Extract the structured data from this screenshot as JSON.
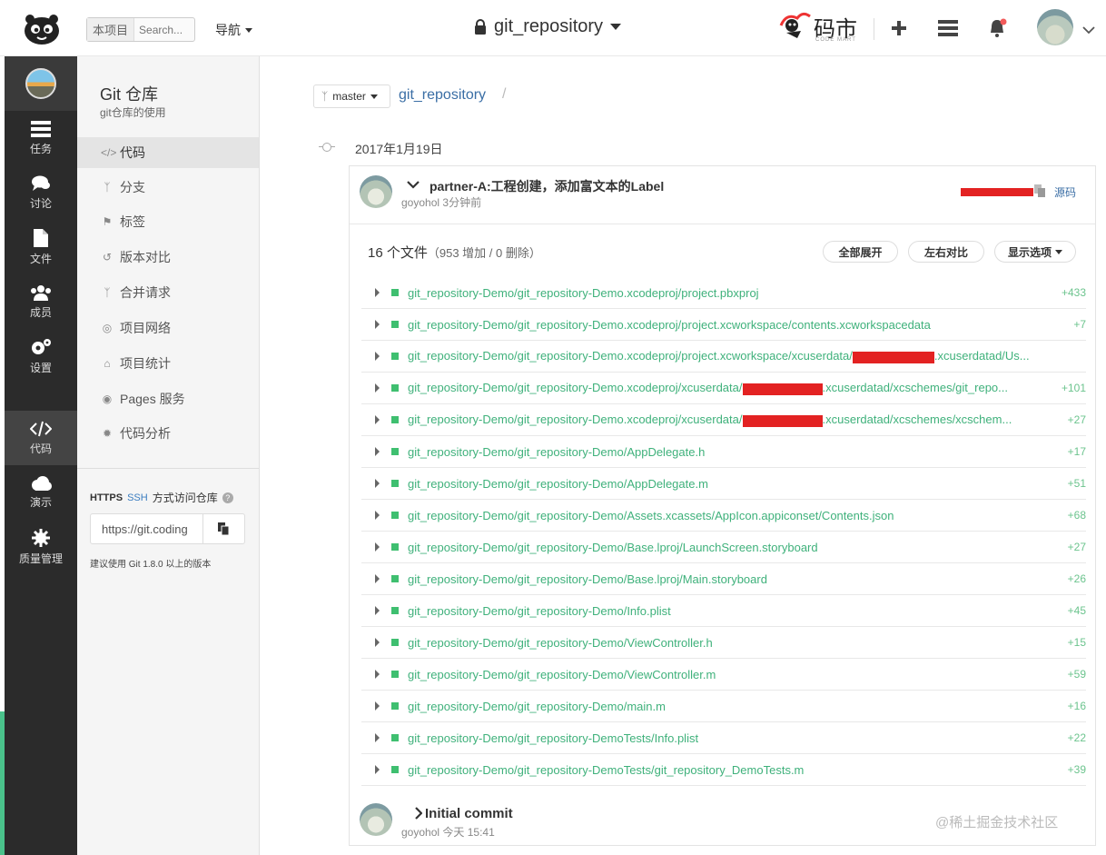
{
  "header": {
    "search_scope": "本项目",
    "search_placeholder": "Search...",
    "nav_label": "导航",
    "repo_name": "git_repository",
    "brand": "码市",
    "brand_sub": "CODE MART"
  },
  "dark_nav": [
    {
      "label": "任务",
      "icon": "tasks-icon"
    },
    {
      "label": "讨论",
      "icon": "discussion-icon"
    },
    {
      "label": "文件",
      "icon": "file-icon"
    },
    {
      "label": "成员",
      "icon": "members-icon"
    },
    {
      "label": "设置",
      "icon": "settings-icon"
    },
    {
      "label": "代码",
      "icon": "code-icon"
    },
    {
      "label": "演示",
      "icon": "cloud-icon"
    },
    {
      "label": "质量管理",
      "icon": "quality-icon"
    }
  ],
  "sidebar": {
    "title": "Git 仓库",
    "subtitle": "git仓库的使用",
    "items": [
      {
        "label": "代码",
        "icon": "code-icon"
      },
      {
        "label": "分支",
        "icon": "branch-icon"
      },
      {
        "label": "标签",
        "icon": "tag-icon"
      },
      {
        "label": "版本对比",
        "icon": "compare-icon"
      },
      {
        "label": "合并请求",
        "icon": "merge-request-icon"
      },
      {
        "label": "项目网络",
        "icon": "network-icon"
      },
      {
        "label": "项目统计",
        "icon": "stats-icon"
      },
      {
        "label": "Pages 服务",
        "icon": "pages-icon"
      },
      {
        "label": "代码分析",
        "icon": "analysis-icon"
      }
    ],
    "clone": {
      "https": "HTTPS",
      "ssh": "SSH",
      "label": "方式访问仓库",
      "url": "https://git.coding",
      "hint": "建议使用 Git 1.8.0 以上的版本"
    }
  },
  "main": {
    "branch": "master",
    "crumb": "git_repository",
    "crumb_sep": "/",
    "date": "2017年1月19日",
    "commit": {
      "message": "partner-A:工程创建，添加富文本的Label",
      "author": "goyohol",
      "time": "3分钟前",
      "source_label": "源码"
    },
    "files_summary": "16 个文件",
    "files_stats": "（953 增加 / 0 删除）",
    "buttons": {
      "expand_all": "全部展开",
      "side_by_side": "左右对比",
      "display_options": "显示选项"
    },
    "files": [
      {
        "pre": "git_repository-Demo/git_repository-Demo.xcodeproj/project.pbxproj",
        "post": "",
        "additions": "+433"
      },
      {
        "pre": "git_repository-Demo/git_repository-Demo.xcodeproj/project.xcworkspace/contents.xcworkspacedata",
        "post": "",
        "additions": "+7"
      },
      {
        "pre": "git_repository-Demo/git_repository-Demo.xcodeproj/project.xcworkspace/xcuserdata/",
        "post": ".xcuserdatad/Us...",
        "additions": ""
      },
      {
        "pre": "git_repository-Demo/git_repository-Demo.xcodeproj/xcuserdata/",
        "post": ".xcuserdatad/xcschemes/git_repo...",
        "additions": "+101"
      },
      {
        "pre": "git_repository-Demo/git_repository-Demo.xcodeproj/xcuserdata/",
        "post": ".xcuserdatad/xcschemes/xcschem...",
        "additions": "+27"
      },
      {
        "pre": "git_repository-Demo/git_repository-Demo/AppDelegate.h",
        "post": "",
        "additions": "+17"
      },
      {
        "pre": "git_repository-Demo/git_repository-Demo/AppDelegate.m",
        "post": "",
        "additions": "+51"
      },
      {
        "pre": "git_repository-Demo/git_repository-Demo/Assets.xcassets/AppIcon.appiconset/Contents.json",
        "post": "",
        "additions": "+68"
      },
      {
        "pre": "git_repository-Demo/git_repository-Demo/Base.lproj/LaunchScreen.storyboard",
        "post": "",
        "additions": "+27"
      },
      {
        "pre": "git_repository-Demo/git_repository-Demo/Base.lproj/Main.storyboard",
        "post": "",
        "additions": "+26"
      },
      {
        "pre": "git_repository-Demo/git_repository-Demo/Info.plist",
        "post": "",
        "additions": "+45"
      },
      {
        "pre": "git_repository-Demo/git_repository-Demo/ViewController.h",
        "post": "",
        "additions": "+15"
      },
      {
        "pre": "git_repository-Demo/git_repository-Demo/ViewController.m",
        "post": "",
        "additions": "+59"
      },
      {
        "pre": "git_repository-Demo/git_repository-Demo/main.m",
        "post": "",
        "additions": "+16"
      },
      {
        "pre": "git_repository-Demo/git_repository-DemoTests/Info.plist",
        "post": "",
        "additions": "+22"
      },
      {
        "pre": "git_repository-Demo/git_repository-DemoTests/git_repository_DemoTests.m",
        "post": "",
        "additions": "+39"
      }
    ],
    "commit2": {
      "message": "Initial commit",
      "author": "goyohol",
      "time": "今天 15:41",
      "watermark": "@稀土掘金技术社区"
    }
  },
  "colors": {
    "link": "#3a6ea5",
    "file_path": "#3fb17b",
    "additions": "#6cc48e",
    "redaction": "#e32222",
    "dark_sidebar": "#2b2b2b"
  }
}
